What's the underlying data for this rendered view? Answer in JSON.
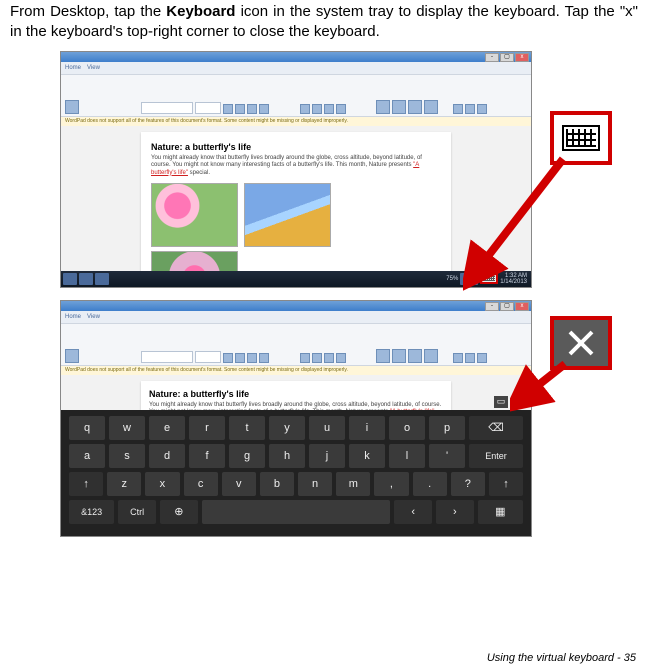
{
  "intro": {
    "pre": "From Desktop, tap the ",
    "bold": "Keyboard",
    "post": " icon in the system tray to display the keyboard. Tap the \"x\" in the keyboard's top-right corner to close the keyboard."
  },
  "ribbon_tabs": [
    "Home",
    "View"
  ],
  "warn_text": "WordPad does not support all of the features of this document's format. Some content might be missing or displayed improperly.",
  "doc": {
    "title1": "Nature: a butterfly's life",
    "title2": "Nature: a butterfly's life",
    "body_a": "You might already know that butterfly lives broadly around the globe, cross altitude, beyond latitude, of course. You might not know many interesting facts of a butterfly's life. This month, Nature presents ",
    "body_red": "\"A butterfly's life\"",
    "body_b": " special."
  },
  "taskbar": {
    "clock_time": "1:32 AM",
    "clock_date": "1/14/2013",
    "zoom": "75%"
  },
  "osk": {
    "row1": [
      "q",
      "w",
      "e",
      "r",
      "t",
      "y",
      "u",
      "i",
      "o",
      "p"
    ],
    "bksp": "⌫",
    "row2": [
      "a",
      "s",
      "d",
      "f",
      "g",
      "h",
      "j",
      "k",
      "l",
      "'"
    ],
    "enter": "Enter",
    "row3": [
      "z",
      "x",
      "c",
      "v",
      "b",
      "n",
      "m",
      ",",
      ".",
      "?"
    ],
    "shift": "↑",
    "row4_left": [
      "&123",
      "Ctrl"
    ],
    "globe": "⊕",
    "left": "‹",
    "right": "›"
  },
  "callouts": {
    "keyboard_name": "keyboard-icon",
    "close_name": "close-x-icon"
  },
  "footer": {
    "text": "Using the virtual keyboard -  35"
  }
}
